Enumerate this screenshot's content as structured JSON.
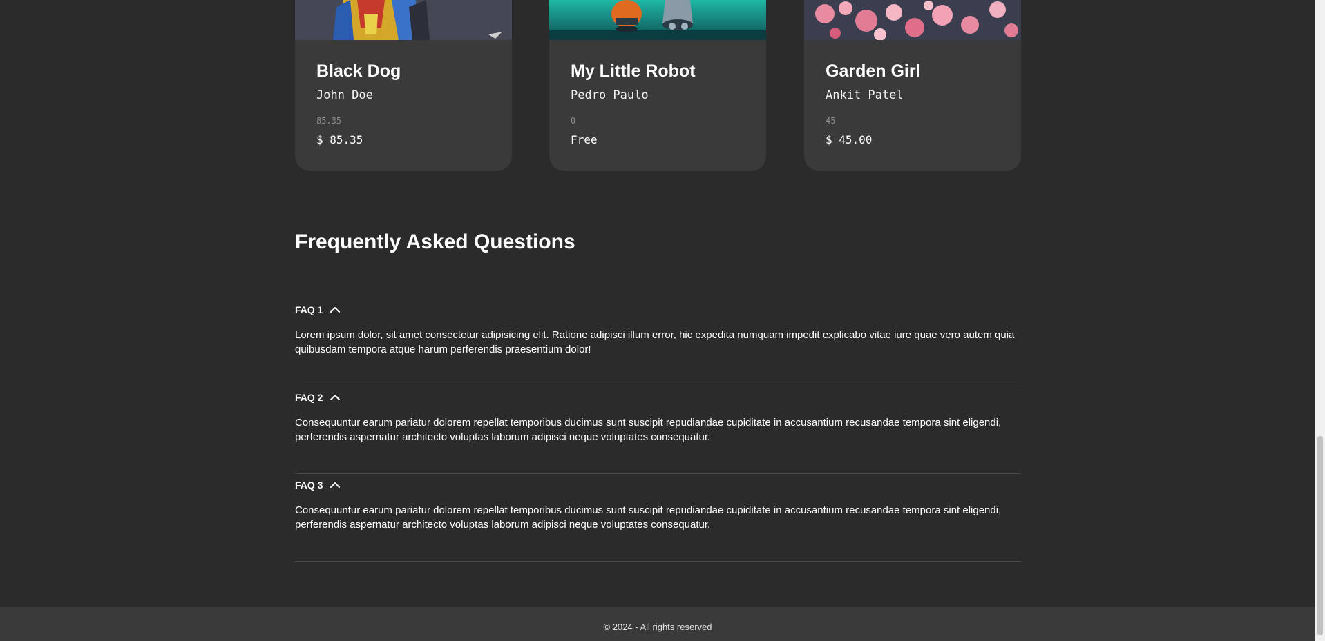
{
  "products": [
    {
      "title": "Black Dog",
      "artist": "John Doe",
      "raw_price": "85.35",
      "price": "$ 85.35",
      "image_icon": "dog-artwork-image"
    },
    {
      "title": "My Little Robot",
      "artist": "Pedro Paulo",
      "raw_price": "0",
      "price": "Free",
      "image_icon": "robot-artwork-image"
    },
    {
      "title": "Garden Girl",
      "artist": "Ankit Patel",
      "raw_price": "45",
      "price": "$ 45.00",
      "image_icon": "cherry-blossom-artwork-image"
    }
  ],
  "faq": {
    "title": "Frequently Asked Questions",
    "items": [
      {
        "label": "FAQ 1",
        "icon": "chevron-up-icon",
        "answer": "Lorem ipsum dolor, sit amet consectetur adipisicing elit. Ratione adipisci illum error, hic expedita numquam impedit explicabo vitae iure quae vero autem quia quibusdam tempora atque harum perferendis praesentium dolor!"
      },
      {
        "label": "FAQ 2",
        "icon": "chevron-up-icon",
        "answer": "Consequuntur earum pariatur dolorem repellat temporibus ducimus sunt suscipit repudiandae cupiditate in accusantium recusandae tempora sint eligendi, perferendis aspernatur architecto voluptas laborum adipisci neque voluptates consequatur."
      },
      {
        "label": "FAQ 3",
        "icon": "chevron-up-icon",
        "answer": "Consequuntur earum pariatur dolorem repellat temporibus ducimus sunt suscipit repudiandae cupiditate in accusantium recusandae tempora sint eligendi, perferendis aspernatur architecto voluptas laborum adipisci neque voluptates consequatur."
      }
    ]
  },
  "footer": {
    "text": "© 2024 - All rights reserved"
  },
  "colors": {
    "background": "#2b2b2b",
    "card": "#3a3a3a",
    "footer": "#3a3a3a",
    "muted_text": "#8c8c8c"
  }
}
